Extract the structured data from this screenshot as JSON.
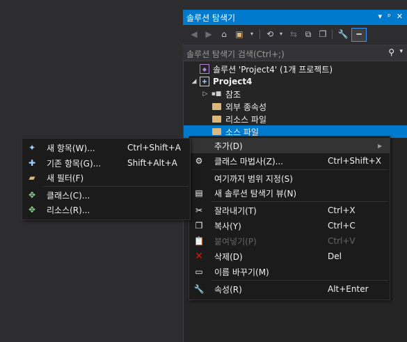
{
  "panel": {
    "title": "솔루션 탐색기",
    "title_buttons": [
      "▾",
      "ᵖ",
      "✕"
    ],
    "search_placeholder": "솔루션 탐색기 검색(Ctrl+;)"
  },
  "tree": [
    {
      "label": "솔루션 'Project4' (1개 프로젝트)",
      "icon": "solution-icon"
    },
    {
      "label": "Project4",
      "icon": "project-icon",
      "bold": true
    },
    {
      "label": "참조",
      "icon": "references-icon"
    },
    {
      "label": "외부 종속성",
      "icon": "folder-icon"
    },
    {
      "label": "리소스 파일",
      "icon": "folder-icon"
    },
    {
      "label": "소스 파일",
      "icon": "folder-icon",
      "selected": true
    }
  ],
  "context_menu": {
    "items": [
      {
        "label": "추가(D)",
        "shortcut": "",
        "icon": "",
        "submenu": true
      },
      {
        "label": "클래스 마법사(Z)...",
        "shortcut": "Ctrl+Shift+X",
        "icon": "class-wizard-icon"
      },
      {
        "label": "여기까지 범위 지정(S)",
        "shortcut": "",
        "icon": ""
      },
      {
        "label": "새 솔루션 탐색기 뷰(N)",
        "shortcut": "",
        "icon": "new-view-icon"
      },
      {
        "label": "잘라내기(T)",
        "shortcut": "Ctrl+X",
        "icon": "cut-icon"
      },
      {
        "label": "복사(Y)",
        "shortcut": "Ctrl+C",
        "icon": "copy-icon"
      },
      {
        "label": "붙여넣기(P)",
        "shortcut": "Ctrl+V",
        "icon": "paste-icon",
        "disabled": true
      },
      {
        "label": "삭제(D)",
        "shortcut": "Del",
        "icon": "delete-icon"
      },
      {
        "label": "이름 바꾸기(M)",
        "shortcut": "",
        "icon": "rename-icon"
      },
      {
        "label": "속성(R)",
        "shortcut": "Alt+Enter",
        "icon": "properties-icon"
      }
    ]
  },
  "add_submenu": {
    "items": [
      {
        "label": "새 항목(W)...",
        "shortcut": "Ctrl+Shift+A",
        "icon": "new-item-icon"
      },
      {
        "label": "기존 항목(G)...",
        "shortcut": "Shift+Alt+A",
        "icon": "existing-item-icon"
      },
      {
        "label": "새 필터(F)",
        "shortcut": "",
        "icon": "new-filter-icon"
      },
      {
        "label": "클래스(C)...",
        "shortcut": "",
        "icon": "class-icon"
      },
      {
        "label": "리소스(R)...",
        "shortcut": "",
        "icon": "resource-icon"
      }
    ]
  },
  "colors": {
    "accent": "#007acc",
    "background": "#2d2d30",
    "menu_bg": "#1b1b1c"
  }
}
